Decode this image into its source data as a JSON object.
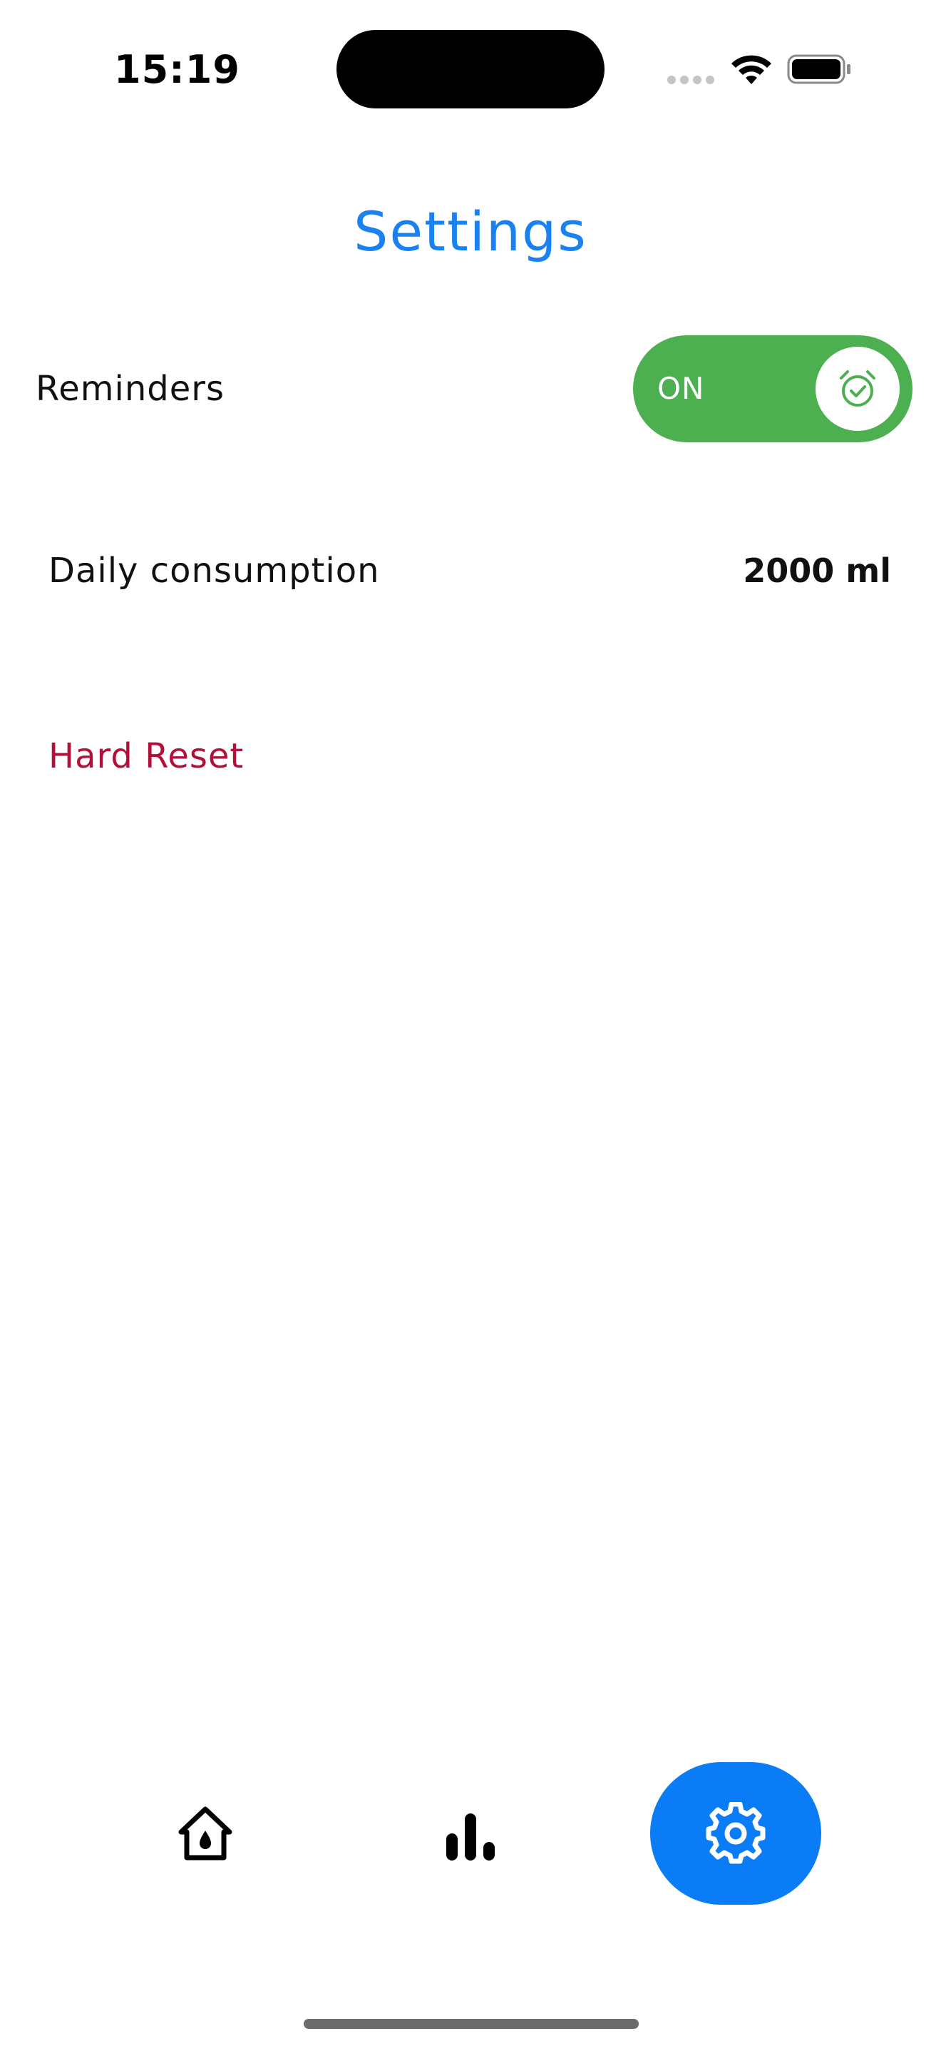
{
  "status_bar": {
    "time": "15:19"
  },
  "header": {
    "title": "Settings"
  },
  "reminders": {
    "label": "Reminders",
    "toggle_state": "ON",
    "enabled": true,
    "toggle_color": "#4caf50",
    "icon": "alarm-check-icon"
  },
  "daily_consumption": {
    "label": "Daily consumption",
    "value": "2000 ml"
  },
  "hard_reset": {
    "label": "Hard Reset",
    "color": "#b0103a"
  },
  "tab_bar": {
    "tabs": [
      {
        "id": "home",
        "icon": "home-drop-icon",
        "active": false
      },
      {
        "id": "stats",
        "icon": "bar-chart-icon",
        "active": false
      },
      {
        "id": "settings",
        "icon": "gear-icon",
        "active": true
      }
    ],
    "active_color": "#0a7cf5"
  },
  "colors": {
    "title": "#1a82f0",
    "accent": "#0a7cf5",
    "toggle_on": "#4caf50",
    "destructive": "#b0103a"
  }
}
